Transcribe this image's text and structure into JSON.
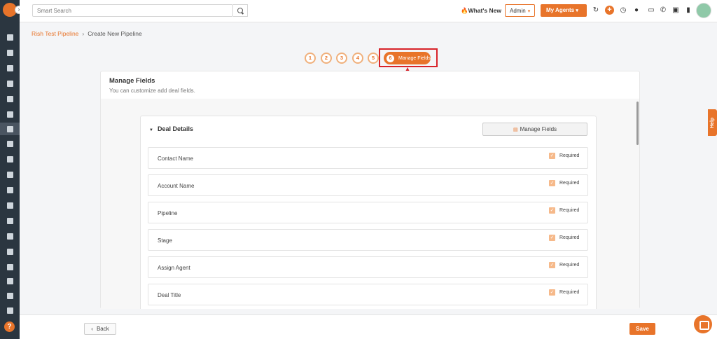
{
  "topbar": {
    "search_placeholder": "Smart Search",
    "whats_new": "What's New",
    "role": "Admin",
    "agents_button": "My Agents",
    "icons": [
      "refresh-icon",
      "plus-icon",
      "clock-icon",
      "bell-icon",
      "switch-icon",
      "phone-icon",
      "chip-icon",
      "doc-icon"
    ]
  },
  "breadcrumb": {
    "parent": "Rish Test Pipeline",
    "current": "Create New Pipeline"
  },
  "steps": [
    "1",
    "2",
    "3",
    "4",
    "5"
  ],
  "active_step": {
    "number": "6",
    "label": "Manage Fields"
  },
  "card": {
    "title": "Manage Fields",
    "subtitle": "You can customize add deal fields."
  },
  "section": {
    "title": "Deal Details",
    "manage_button": "Manage Fields",
    "fields": [
      {
        "name": "Contact Name",
        "required_label": "Required",
        "required": true
      },
      {
        "name": "Account Name",
        "required_label": "Required",
        "required": true
      },
      {
        "name": "Pipeline",
        "required_label": "Required",
        "required": true
      },
      {
        "name": "Stage",
        "required_label": "Required",
        "required": true
      },
      {
        "name": "Assign Agent",
        "required_label": "Required",
        "required": true
      },
      {
        "name": "Deal Title",
        "required_label": "Required",
        "required": true
      }
    ]
  },
  "footer": {
    "back": "Back",
    "save": "Save"
  },
  "help_tab": "Help",
  "colors": {
    "accent": "#e8742a",
    "sidebar": "#2b3640",
    "annotation": "#d8232a"
  }
}
